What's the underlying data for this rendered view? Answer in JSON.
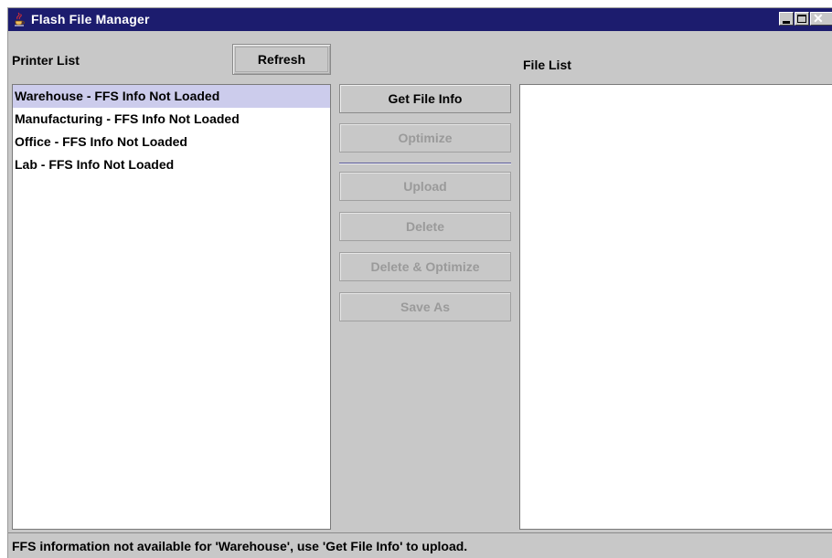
{
  "window": {
    "title": "Flash File Manager",
    "icon": "java-cup-icon",
    "controls": [
      "minimize-icon",
      "maximize-icon",
      "close-icon"
    ]
  },
  "printer_panel": {
    "label": "Printer List",
    "refresh_label": "Refresh",
    "items": [
      {
        "label": "Warehouse - FFS Info Not Loaded",
        "selected": true
      },
      {
        "label": "Manufacturing - FFS Info Not Loaded",
        "selected": false
      },
      {
        "label": "Office - FFS Info Not Loaded",
        "selected": false
      },
      {
        "label": "Lab - FFS Info Not Loaded",
        "selected": false
      }
    ]
  },
  "actions": {
    "get_file_info": {
      "label": "Get File Info",
      "enabled": true
    },
    "optimize": {
      "label": "Optimize",
      "enabled": false
    },
    "upload": {
      "label": "Upload",
      "enabled": false
    },
    "delete": {
      "label": "Delete",
      "enabled": false
    },
    "delete_optimize": {
      "label": "Delete & Optimize",
      "enabled": false
    },
    "save_as": {
      "label": "Save As",
      "enabled": false
    }
  },
  "file_panel": {
    "label": "File List",
    "items": []
  },
  "status": {
    "text": "FFS information not available for 'Warehouse', use 'Get File Info' to upload."
  },
  "colors": {
    "titlebar": "#1c1c6e",
    "window_bg": "#c8c8c8",
    "selection": "#ccccec",
    "disabled_text": "#9a9a9a"
  }
}
